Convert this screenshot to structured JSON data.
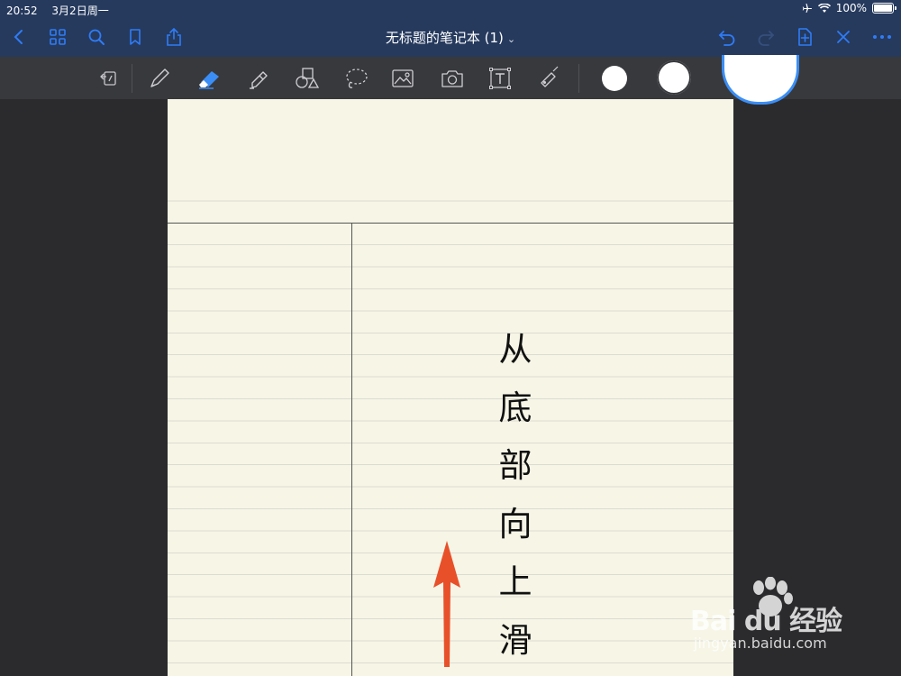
{
  "status_bar": {
    "time": "20:52",
    "date": "3月2日周一",
    "battery": "100%"
  },
  "nav": {
    "title": "无标题的笔记本 (1)",
    "back_icon": "chevron-left-icon",
    "grid_icon": "grid-icon",
    "search_icon": "search-icon",
    "bookmark_icon": "bookmark-icon",
    "share_icon": "share-icon",
    "undo_icon": "undo-icon",
    "redo_icon": "redo-icon",
    "add_page_icon": "add-page-icon",
    "close_icon": "close-icon",
    "more_icon": "more-icon",
    "accent_color": "#2f7cf6"
  },
  "toolbar": {
    "tools": [
      "read-only-icon",
      "pen-icon",
      "eraser-icon",
      "highlighter-icon",
      "shapes-icon",
      "lasso-icon",
      "image-icon",
      "camera-icon",
      "text-icon",
      "laser-pointer-icon"
    ],
    "active_tool": "eraser-icon"
  },
  "page": {
    "paper_color": "#f6f5e6",
    "hint_chars": [
      "从",
      "底",
      "部",
      "向",
      "上",
      "滑"
    ],
    "arrow_color": "#e8502a"
  },
  "watermark": {
    "brand": "Bai du 经验",
    "url": "jingyan.baidu.com"
  }
}
